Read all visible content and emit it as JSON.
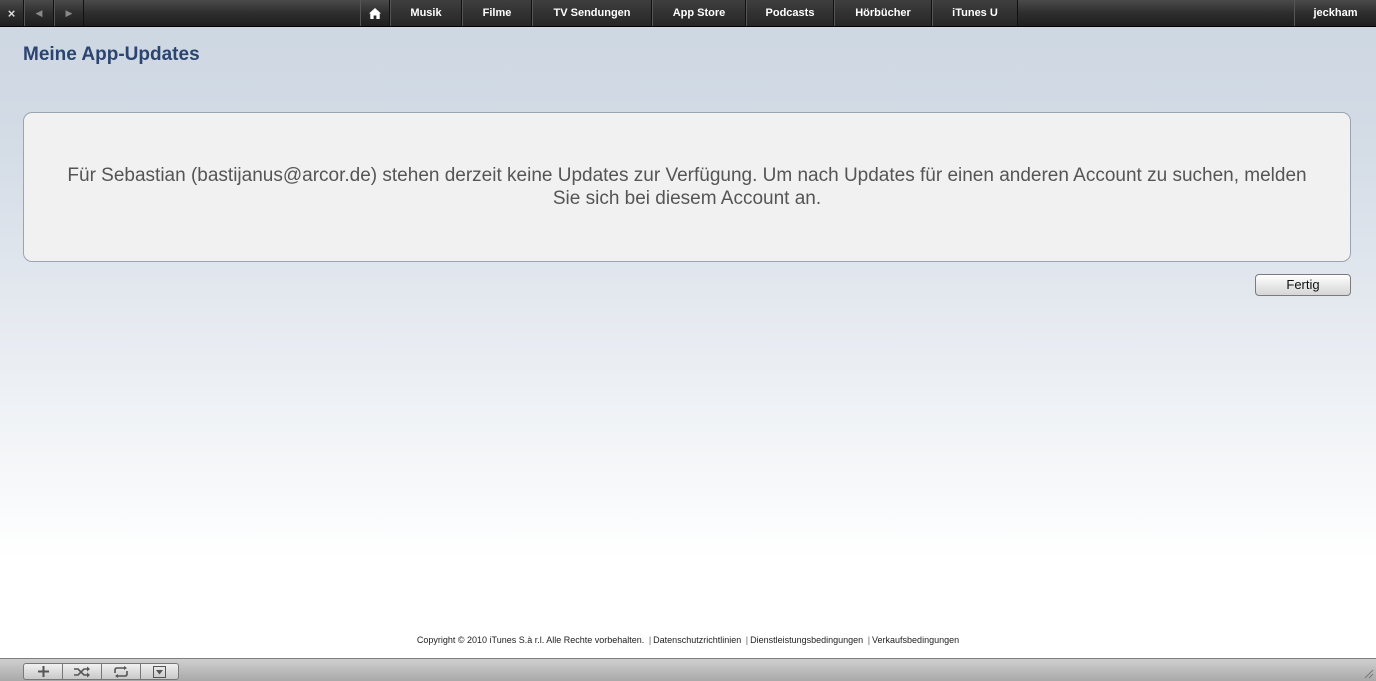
{
  "toolbar": {
    "close_symbol": "×",
    "back_symbol": "◀",
    "forward_symbol": "▶",
    "home_icon": "home-icon",
    "nav_items": [
      "Musik",
      "Filme",
      "TV Sendungen",
      "App Store",
      "Podcasts",
      "Hörbücher",
      "iTunes U"
    ],
    "user": "jeckham"
  },
  "page": {
    "title": "Meine App-Updates",
    "message": "Für Sebastian (bastijanus@arcor.de) stehen derzeit keine Updates zur Verfügung. Um nach Updates für einen anderen Account zu suchen, melden Sie sich bei diesem Account an.",
    "done_label": "Fertig"
  },
  "footer": {
    "copyright": "Copyright © 2010 iTunes S.à r.l. Alle Rechte vorbehalten.",
    "separator": "|",
    "links": [
      "Datenschutzrichtlinien",
      "Dienstleistungsbedingungen",
      "Verkaufsbedingungen"
    ]
  },
  "bottom_controls": {
    "icons": [
      "add-icon",
      "shuffle-icon",
      "repeat-icon",
      "eject-icon"
    ]
  },
  "colors": {
    "title": "#2b4470",
    "message_text": "#555555",
    "toolbar_bg": "#2e2e2e"
  }
}
